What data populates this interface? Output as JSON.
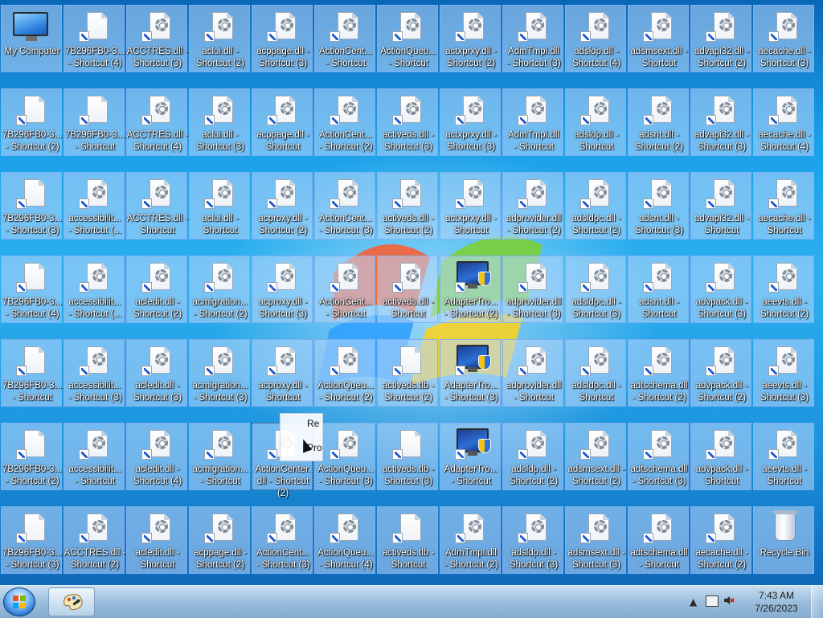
{
  "desktop": {
    "wallpaper": "windows-7-default",
    "icons": [
      {
        "label": "My Computer",
        "type": "computer"
      },
      {
        "label": "7B296FB0-3...\n- Shortcut (4)",
        "type": "file",
        "shortcut": true
      },
      {
        "label": "ACCTRES.dll -\nShortcut (3)",
        "type": "gear",
        "shortcut": true
      },
      {
        "label": "aclui.dll -\nShortcut (2)",
        "type": "gear",
        "shortcut": true
      },
      {
        "label": "acppage.dll -\nShortcut (3)",
        "type": "gear",
        "shortcut": true
      },
      {
        "label": "ActionCent...\n- Shortcut",
        "type": "gear",
        "shortcut": true
      },
      {
        "label": "ActionQueu...\n- Shortcut",
        "type": "gear",
        "shortcut": true
      },
      {
        "label": "actxprxy.dll -\nShortcut (2)",
        "type": "gear",
        "shortcut": true
      },
      {
        "label": "AdmTmpl.dll\n- Shortcut (3)",
        "type": "gear",
        "shortcut": true
      },
      {
        "label": "adsldp.dll -\nShortcut (4)",
        "type": "gear",
        "shortcut": true
      },
      {
        "label": "adsmsext.dll -\nShortcut",
        "type": "gear",
        "shortcut": true
      },
      {
        "label": "advapi32.dll -\nShortcut (2)",
        "type": "gear",
        "shortcut": true
      },
      {
        "label": "aecache.dll -\nShortcut (3)",
        "type": "gear",
        "shortcut": true
      },
      {
        "label": "7B296FB0-3...\n- Shortcut (2)",
        "type": "file",
        "shortcut": true
      },
      {
        "label": "7B296FB0-3...\n- Shortcut",
        "type": "file",
        "shortcut": true
      },
      {
        "label": "ACCTRES.dll -\nShortcut (4)",
        "type": "gear",
        "shortcut": true
      },
      {
        "label": "aclui.dll -\nShortcut (3)",
        "type": "gear",
        "shortcut": true
      },
      {
        "label": "acppage.dll -\nShortcut",
        "type": "gear",
        "shortcut": true
      },
      {
        "label": "ActionCent...\n- Shortcut (2)",
        "type": "gear",
        "shortcut": true
      },
      {
        "label": "activeds.dll -\nShortcut (3)",
        "type": "gear",
        "shortcut": true
      },
      {
        "label": "actxprxy.dll -\nShortcut (3)",
        "type": "gear",
        "shortcut": true
      },
      {
        "label": "AdmTmpl.dll\n- Shortcut",
        "type": "gear",
        "shortcut": true
      },
      {
        "label": "adsldp.dll -\nShortcut",
        "type": "gear",
        "shortcut": true
      },
      {
        "label": "adsnt.dll -\nShortcut (2)",
        "type": "gear",
        "shortcut": true
      },
      {
        "label": "advapi32.dll -\nShortcut (3)",
        "type": "gear",
        "shortcut": true
      },
      {
        "label": "aecache.dll -\nShortcut (4)",
        "type": "gear",
        "shortcut": true
      },
      {
        "label": "7B296FB0-3...\n- Shortcut (3)",
        "type": "file",
        "shortcut": true
      },
      {
        "label": "accessibilit...\n- Shortcut (...",
        "type": "gear",
        "shortcut": true
      },
      {
        "label": "ACCTRES.dll -\nShortcut",
        "type": "gear",
        "shortcut": true
      },
      {
        "label": "aclui.dll -\nShortcut",
        "type": "gear",
        "shortcut": true
      },
      {
        "label": "acproxy.dll -\nShortcut (2)",
        "type": "gear",
        "shortcut": true
      },
      {
        "label": "ActionCent...\n- Shortcut (3)",
        "type": "gear",
        "shortcut": true
      },
      {
        "label": "activeds.dll -\nShortcut (2)",
        "type": "gear",
        "shortcut": true
      },
      {
        "label": "actxprxy.dll -\nShortcut",
        "type": "gear",
        "shortcut": true
      },
      {
        "label": "adprovider.dll\n- Shortcut (2)",
        "type": "gear",
        "shortcut": true
      },
      {
        "label": "adsldpc.dll -\nShortcut (2)",
        "type": "gear",
        "shortcut": true
      },
      {
        "label": "adsnt.dll -\nShortcut (3)",
        "type": "gear",
        "shortcut": true
      },
      {
        "label": "advapi32.dll -\nShortcut",
        "type": "gear",
        "shortcut": true
      },
      {
        "label": "aecache.dll -\nShortcut",
        "type": "gear",
        "shortcut": true
      },
      {
        "label": "7B296FB0-3...\n- Shortcut (4)",
        "type": "file",
        "shortcut": true
      },
      {
        "label": "accessibilit...\n- Shortcut (...",
        "type": "gear",
        "shortcut": true
      },
      {
        "label": "acledit.dll -\nShortcut (2)",
        "type": "gear",
        "shortcut": true
      },
      {
        "label": "acmigration...\n- Shortcut (2)",
        "type": "gear",
        "shortcut": true
      },
      {
        "label": "acproxy.dll -\nShortcut (3)",
        "type": "gear",
        "shortcut": true
      },
      {
        "label": "ActionCent...\n- Shortcut",
        "type": "gear",
        "shortcut": true
      },
      {
        "label": "activeds.dll -\nShortcut",
        "type": "gear",
        "shortcut": true
      },
      {
        "label": "AdapterTro...\n- Shortcut (2)",
        "type": "monitor",
        "shortcut": true
      },
      {
        "label": "adprovider.dll\n- Shortcut (3)",
        "type": "gear",
        "shortcut": true
      },
      {
        "label": "adsldpc.dll -\nShortcut (3)",
        "type": "gear",
        "shortcut": true
      },
      {
        "label": "adsnt.dll -\nShortcut",
        "type": "gear",
        "shortcut": true
      },
      {
        "label": "advpack.dll -\nShortcut (3)",
        "type": "gear",
        "shortcut": true
      },
      {
        "label": "aeevts.dll -\nShortcut (2)",
        "type": "gear",
        "shortcut": true
      },
      {
        "label": "7B296FB0-3...\n- Shortcut",
        "type": "file",
        "shortcut": true
      },
      {
        "label": "accessibilit...\n- Shortcut (3)",
        "type": "gear",
        "shortcut": true
      },
      {
        "label": "acledit.dll -\nShortcut (3)",
        "type": "gear",
        "shortcut": true
      },
      {
        "label": "acmigration...\n- Shortcut (3)",
        "type": "gear",
        "shortcut": true
      },
      {
        "label": "acproxy.dll -\nShortcut",
        "type": "gear",
        "shortcut": true
      },
      {
        "label": "ActionQueu...\n- Shortcut (2)",
        "type": "gear",
        "shortcut": true
      },
      {
        "label": "activeds.tlb -\nShortcut (2)",
        "type": "file",
        "shortcut": true
      },
      {
        "label": "AdapterTro...\n- Shortcut (3)",
        "type": "monitor",
        "shortcut": true
      },
      {
        "label": "adprovider.dll\n- Shortcut",
        "type": "gear",
        "shortcut": true
      },
      {
        "label": "adsldpc.dll -\nShortcut",
        "type": "gear",
        "shortcut": true
      },
      {
        "label": "adtschema.dll\n- Shortcut (2)",
        "type": "gear",
        "shortcut": true
      },
      {
        "label": "advpack.dll -\nShortcut (2)",
        "type": "gear",
        "shortcut": true
      },
      {
        "label": "aeevts.dll -\nShortcut (3)",
        "type": "gear",
        "shortcut": true
      },
      {
        "label": "7B296FB0-3...\n- Shortcut (2)",
        "type": "file",
        "shortcut": true
      },
      {
        "label": "accessibilit...\n- Shortcut",
        "type": "gear",
        "shortcut": true
      },
      {
        "label": "acledit.dll -\nShortcut (4)",
        "type": "gear",
        "shortcut": true
      },
      {
        "label": "acmigration...\n- Shortcut",
        "type": "gear",
        "shortcut": true
      },
      {
        "label": "ActionCenter.\ndll - Shortcut\n(2)",
        "type": "gear",
        "shortcut": true,
        "focused": true
      },
      {
        "label": "ActionQueu...\n- Shortcut (3)",
        "type": "gear",
        "shortcut": true
      },
      {
        "label": "activeds.tlb -\nShortcut (3)",
        "type": "file",
        "shortcut": true
      },
      {
        "label": "AdapterTro...\n- Shortcut",
        "type": "monitor",
        "shortcut": true
      },
      {
        "label": "adsldp.dll -\nShortcut (2)",
        "type": "gear",
        "shortcut": true
      },
      {
        "label": "adsmsext.dll -\nShortcut (2)",
        "type": "gear",
        "shortcut": true
      },
      {
        "label": "adtschema.dll\n- Shortcut (3)",
        "type": "gear",
        "shortcut": true
      },
      {
        "label": "advpack.dll -\nShortcut",
        "type": "gear",
        "shortcut": true
      },
      {
        "label": "aeevts.dll -\nShortcut",
        "type": "gear",
        "shortcut": true
      },
      {
        "label": "7B296FB0-3...\n- Shortcut (3)",
        "type": "file",
        "shortcut": true
      },
      {
        "label": "ACCTRES.dll -\nShortcut (2)",
        "type": "gear",
        "shortcut": true
      },
      {
        "label": "acledit.dll -\nShortcut",
        "type": "gear",
        "shortcut": true
      },
      {
        "label": "acppage.dll -\nShortcut (2)",
        "type": "gear",
        "shortcut": true
      },
      {
        "label": "ActionCent...\n- Shortcut (3)",
        "type": "gear",
        "shortcut": true
      },
      {
        "label": "ActionQueu...\n- Shortcut (4)",
        "type": "gear",
        "shortcut": true
      },
      {
        "label": "activeds.tlb -\nShortcut",
        "type": "file",
        "shortcut": true
      },
      {
        "label": "AdmTmpl.dll\n- Shortcut (2)",
        "type": "gear",
        "shortcut": true
      },
      {
        "label": "adsldp.dll -\nShortcut (3)",
        "type": "gear",
        "shortcut": true
      },
      {
        "label": "adsmsext.dll -\nShortcut (3)",
        "type": "gear",
        "shortcut": true
      },
      {
        "label": "adtschema.dll\n- Shortcut",
        "type": "gear",
        "shortcut": true
      },
      {
        "label": "aecache.dll -\nShortcut (2)",
        "type": "gear",
        "shortcut": true
      },
      {
        "label": "Recycle Bin",
        "type": "bin"
      }
    ],
    "drag_ghost": {
      "text_line1": "Re",
      "text_line2": "Pro"
    }
  },
  "taskbar": {
    "start_button_label": "Start",
    "pinned": [
      {
        "name": "Paint"
      }
    ],
    "tray": {
      "show_hidden_label": "▲",
      "time": "7:43 AM",
      "date": "7/26/2023"
    }
  }
}
